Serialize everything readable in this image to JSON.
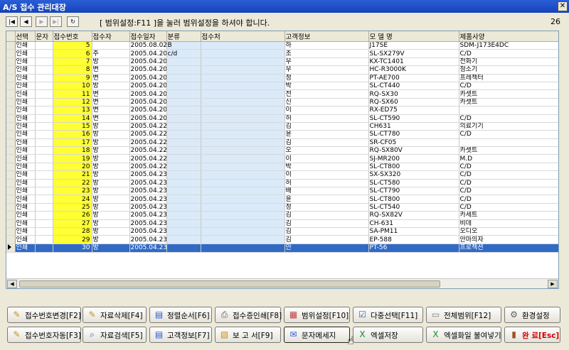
{
  "window": {
    "title": "A/S 접수 관리대장",
    "close_glyph": "✕"
  },
  "navigation": {
    "buttons": [
      {
        "name": "first",
        "glyph": "|◀",
        "enabled": true
      },
      {
        "name": "prev",
        "glyph": "◀",
        "enabled": true
      },
      {
        "name": "next",
        "glyph": "▶",
        "enabled": false
      },
      {
        "name": "last",
        "glyph": "▶|",
        "enabled": false
      },
      {
        "name": "refresh",
        "glyph": "↻",
        "enabled": true
      }
    ],
    "message": "[ 범위설정:F11 ]을 눌러 범위설정을 하셔야 합니다.",
    "record_count": "26"
  },
  "grid": {
    "columns": [
      "선택",
      "문자",
      "접수번호",
      "접수자",
      "접수일자",
      "분류",
      "접수처",
      "고객정보",
      "모 델 명",
      "제품사양"
    ],
    "selected_index": 25,
    "rows": [
      [
        "인쇄",
        "",
        "5",
        "",
        "2005.08.02",
        "B",
        "",
        "하",
        "J17SE",
        "SDM-J173E4DC"
      ],
      [
        "인쇄",
        "",
        "6",
        "주",
        "2005.04.20",
        "c/d",
        "",
        "조",
        "SL-SX279V",
        "C/D"
      ],
      [
        "인쇄",
        "",
        "7",
        "방",
        "2005.04.20",
        "",
        "",
        "우",
        "KX-TC1401",
        "전화기"
      ],
      [
        "인쇄",
        "",
        "8",
        "변",
        "2005.04.20",
        "",
        "",
        "우",
        "HC-R3000K",
        "청소기"
      ],
      [
        "인쇄",
        "",
        "9",
        "변",
        "2005.04.20",
        "",
        "",
        "정",
        "PT-AE700",
        "프레젝터"
      ],
      [
        "인쇄",
        "",
        "10",
        "방",
        "2005.04.20",
        "",
        "",
        "박",
        "SL-CT440",
        "C/D"
      ],
      [
        "인쇄",
        "",
        "11",
        "변",
        "2005.04.20",
        "",
        "",
        "전",
        "RQ-SX30",
        "카셋트"
      ],
      [
        "인쇄",
        "",
        "12",
        "변",
        "2005.04.20",
        "",
        "",
        "신",
        "RQ-SX60",
        "카셋트"
      ],
      [
        "인쇄",
        "",
        "13",
        "변",
        "2005.04.20",
        "",
        "",
        "이",
        "RX-ED75",
        ""
      ],
      [
        "인쇄",
        "",
        "14",
        "변",
        "2005.04.20",
        "",
        "",
        "허",
        "SL-CT590",
        "C/D"
      ],
      [
        "인쇄",
        "",
        "15",
        "방",
        "2005.04.22",
        "",
        "",
        "김",
        "CH631",
        "의료기기"
      ],
      [
        "인쇄",
        "",
        "16",
        "방",
        "2005.04.22",
        "",
        "",
        "윤",
        "SL-CT780",
        "C/D"
      ],
      [
        "인쇄",
        "",
        "17",
        "방",
        "2005.04.22",
        "",
        "",
        "김",
        "SR-CF05",
        ""
      ],
      [
        "인쇄",
        "",
        "18",
        "방",
        "2005.04.22",
        "",
        "",
        "오",
        "RQ-SX80V",
        "카셋트"
      ],
      [
        "인쇄",
        "",
        "19",
        "방",
        "2005.04.22",
        "",
        "",
        "이",
        "SJ-MR200",
        "M.D"
      ],
      [
        "인쇄",
        "",
        "20",
        "방",
        "2005.04.22",
        "",
        "",
        "박",
        "SL-CT800",
        "C/D"
      ],
      [
        "인쇄",
        "",
        "21",
        "방",
        "2005.04.23",
        "",
        "",
        "이",
        "SX-SX320",
        "C/D"
      ],
      [
        "인쇄",
        "",
        "22",
        "방",
        "2005.04.23",
        "",
        "",
        "허",
        "SL-CT580",
        "C/D"
      ],
      [
        "인쇄",
        "",
        "23",
        "방",
        "2005.04.23",
        "",
        "",
        "배",
        "SL-CT790",
        "C/D"
      ],
      [
        "인쇄",
        "",
        "24",
        "방",
        "2005.04.23",
        "",
        "",
        "윤",
        "SL-CT800",
        "C/D"
      ],
      [
        "인쇄",
        "",
        "25",
        "방",
        "2005.04.23",
        "",
        "",
        "정",
        "SL-CT540",
        "C/D"
      ],
      [
        "인쇄",
        "",
        "26",
        "방",
        "2005.04.23",
        "",
        "",
        "김",
        "RQ-SX82V",
        "카세트"
      ],
      [
        "인쇄",
        "",
        "27",
        "방",
        "2005.04.23",
        "",
        "",
        "김",
        "CH-631",
        "비데"
      ],
      [
        "인쇄",
        "",
        "28",
        "방",
        "2005.04.23",
        "",
        "",
        "김",
        "SA-PM11",
        "오디오"
      ],
      [
        "인쇄",
        "",
        "29",
        "방",
        "2005.04.23",
        "",
        "",
        "김",
        "EP-588",
        "안마의자"
      ],
      [
        "인쇄",
        "",
        "30",
        "방",
        "2005.04.23",
        "",
        "",
        "안",
        "PT-56",
        "프로젝션"
      ]
    ]
  },
  "buttons": {
    "row1": [
      {
        "name": "change-number",
        "label": "접수번호변경[F2]",
        "icon": "✎",
        "color": "#c89018"
      },
      {
        "name": "delete-data",
        "label": "자료삭제[F4]",
        "icon": "✎",
        "color": "#c89018"
      },
      {
        "name": "sort-order",
        "label": "정렬순서[F6]",
        "icon": "▤",
        "color": "#2a5bd0"
      },
      {
        "name": "print-receipt",
        "label": "접수증인쇄[F8]",
        "icon": "⎙",
        "color": "#555555"
      },
      {
        "name": "set-range",
        "label": "범위설정[F10]",
        "icon": "▦",
        "color": "#c04040"
      },
      {
        "name": "multi-select",
        "label": "다중선택[F11]",
        "icon": "☑",
        "color": "#3060c0"
      },
      {
        "name": "all-range",
        "label": "전체범위[F12]",
        "icon": "▭",
        "color": "#808080"
      },
      {
        "name": "settings",
        "label": "환경설정",
        "icon": "⚙",
        "color": "#606060"
      }
    ],
    "row2": [
      {
        "name": "auto-number",
        "label": "접수번호자동[F3]",
        "icon": "✎",
        "color": "#c89018"
      },
      {
        "name": "search-data",
        "label": "자료검색[F5]",
        "icon": "⌕",
        "color": "#2a5bd0"
      },
      {
        "name": "customer-info",
        "label": "고객정보[F7]",
        "icon": "▤",
        "color": "#2a5bd0"
      },
      {
        "name": "report",
        "label": "보 고 서[F9]",
        "icon": "▧",
        "color": "#c89018"
      },
      {
        "name": "text-message",
        "label": "문자메세지",
        "icon": "✉",
        "color": "#2a5bd0"
      },
      {
        "name": "excel-save",
        "label": "엑셀저장",
        "icon": "X",
        "color": "#1a8a2a"
      },
      {
        "name": "excel-import",
        "label": "엑셀화일 불여넣기",
        "icon": "X",
        "color": "#1a8a2a"
      },
      {
        "name": "exit",
        "label": "완 료[Esc]",
        "icon": "▮",
        "color": "#a05020"
      }
    ]
  }
}
